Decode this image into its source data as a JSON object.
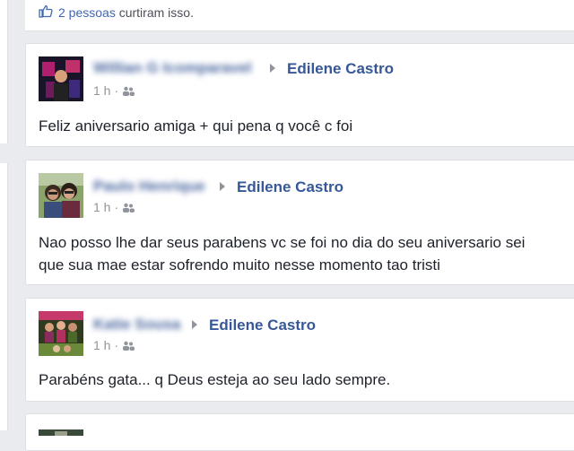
{
  "like_bar": {
    "count_text": "2 pessoas",
    "suffix_text": "curtiram isso."
  },
  "posts": [
    {
      "author": "Willian G Icomparavel",
      "target": "Edilene Castro",
      "time": "1 h ·",
      "message": "Feliz aniversario amiga + qui pena q você c foi"
    },
    {
      "author": "Paulo Henrique",
      "target": "Edilene Castro",
      "time": "1 h ·",
      "message_line1": "Nao posso lhe dar seus parabens vc se foi no dia do seu aniversario sei",
      "message_line2": "que sua mae estar sofrendo muito nesse momento tao tristi"
    },
    {
      "author": "Katie Sousa",
      "target": "Edilene Castro",
      "time": "1 h ·",
      "message": "Parabéns gata... q Deus esteja ao seu lado sempre."
    }
  ],
  "colors": {
    "link": "#365899",
    "background": "#e9ebee",
    "card": "#ffffff"
  },
  "icons": {
    "like": "thumbs-up-icon",
    "audience": "friends-icon",
    "separator": "triangle-right-icon"
  }
}
